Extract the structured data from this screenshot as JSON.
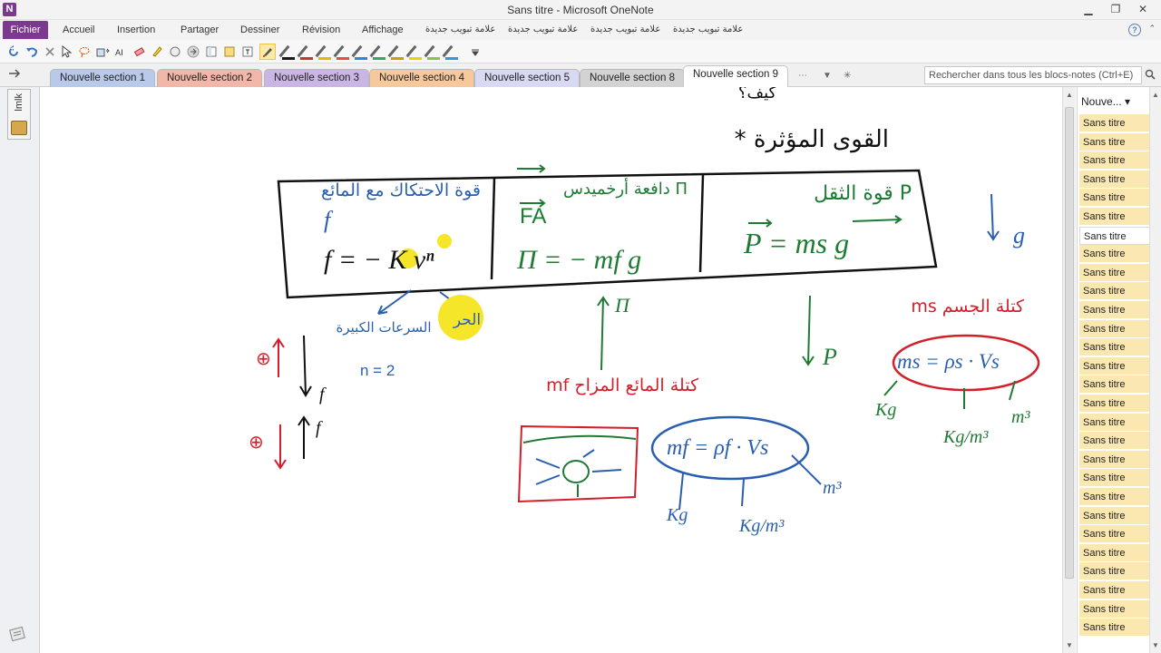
{
  "window": {
    "title": "Sans titre  -  Microsoft OneNote",
    "app_icon": "N",
    "minimize_glyph": "▁",
    "restore_glyph": "❐",
    "close_glyph": "✕"
  },
  "ribbon": {
    "file_tab": "Fichier",
    "tabs": [
      "Accueil",
      "Insertion",
      "Partager",
      "Dessiner",
      "Révision",
      "Affichage"
    ],
    "extra_tabs": [
      "علامة تبويب جديدة",
      "علامة تبويب جديدة",
      "علامة تبويب جديدة",
      "علامة تبويب جديدة"
    ],
    "help_glyph": "?",
    "collapse_glyph": "⌃"
  },
  "toolbar": {
    "pen_colors": [
      "#1a1a1a",
      "#c0392b",
      "#e6b800",
      "#e74c3c",
      "#2e86de",
      "#27ae60",
      "#c8a000",
      "#e6d600",
      "#8bc34a",
      "#3498db"
    ]
  },
  "sections": {
    "back_glyph": "➜",
    "tabs": [
      {
        "label": "Nouvelle section 1",
        "color": "#b8c9ea"
      },
      {
        "label": "Nouvelle section 2",
        "color": "#f2b7a9"
      },
      {
        "label": "Nouvelle section 3",
        "color": "#c9b6e4"
      },
      {
        "label": "Nouvelle section 4",
        "color": "#f7c89b"
      },
      {
        "label": "Nouvelle section 5",
        "color": "#d8d9f2"
      },
      {
        "label": "Nouvelle section 8",
        "color": "#d3d3d3"
      },
      {
        "label": "Nouvelle section 9",
        "color": "#ffffff",
        "current": true
      }
    ],
    "overflow_glyph": "▼",
    "search_placeholder": "Rechercher dans tous les blocs-notes (Ctrl+E)",
    "search_icon": "🔍"
  },
  "left_nav": {
    "notebook_label": "lmlk"
  },
  "pages": {
    "header": "Nouve... ▾",
    "items": [
      "Sans titre",
      "Sans titre",
      "Sans titre",
      "Sans titre",
      "Sans titre",
      "Sans titre",
      "Sans titre",
      "Sans titre",
      "Sans titre",
      "Sans titre",
      "Sans titre",
      "Sans titre",
      "Sans titre",
      "Sans titre",
      "Sans titre",
      "Sans titre",
      "Sans titre",
      "Sans titre",
      "Sans titre",
      "Sans titre",
      "Sans titre",
      "Sans titre",
      "Sans titre",
      "Sans titre",
      "Sans titre",
      "Sans titre",
      "Sans titre",
      "Sans titre"
    ],
    "selected_index": 6
  },
  "notes": {
    "heading": "* القوى المؤثرة",
    "top_fragment": "كيف؟",
    "col3_title": "قوة الثقل P",
    "col3_formula": "P = ms g",
    "col2_title": "دافعة أرخميدس Π",
    "col2_fa": "FA",
    "col2_formula": "Π = − mf g",
    "col1_title": "قوة الاحتكاك مع المائع",
    "col1_f": "f",
    "col1_formula": "f = − K vⁿ",
    "below_col1": "السرعات الكبيرة",
    "n_equals": "n = 2",
    "plus_top": "⊕",
    "plus_bottom": "⊕",
    "f_top": "f",
    "f_bottom": "f",
    "pi_label": "Π",
    "p_label": "P",
    "g_label": "g",
    "mass_fluid_label": "mf كتلة المائع المزاح",
    "formula_fluid": "mf = ρf · Vs",
    "kg": "Kg",
    "kgm3": "Kg/m³",
    "m3": "m³",
    "mass_body_label": "ms كتلة الجسم",
    "formula_body": "ms = ρs · Vs",
    "kg_b": "Kg",
    "kgm3_b": "Kg/m³",
    "m3_b": "m³",
    "highlight_text": "الحر"
  }
}
